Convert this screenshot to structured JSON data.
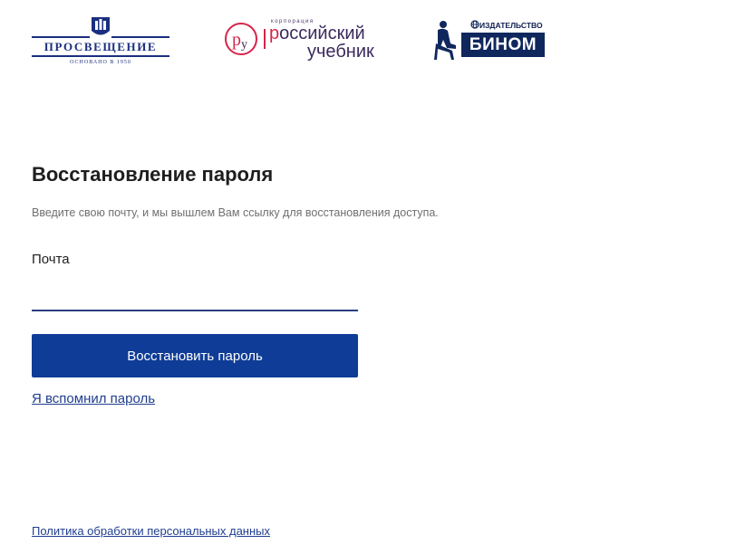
{
  "logos": {
    "prosveshchenie": {
      "name": "ПРОСВЕЩЕНИЕ",
      "since": "ОСНОВАНО В 1950",
      "brand_color": "#1a2f7f"
    },
    "russian_textbook": {
      "corp_label": "корпорация",
      "line1_first": "р",
      "line1_rest": "оссийский",
      "line2": "учебник",
      "accent_color": "#d6244a",
      "brand_color": "#3b2a5e"
    },
    "binom": {
      "publisher_label": "ИЗДАТЕЛЬСТВО",
      "name": "БИНОМ",
      "brand_color": "#10275d"
    }
  },
  "form": {
    "title": "Восстановление пароля",
    "subtitle": "Введите свою почту, и мы вышлем Вам ссылку для восстановления доступа.",
    "email_label": "Почта",
    "email_value": "",
    "submit_label": "Восстановить пароль",
    "remember_link": "Я вспомнил пароль",
    "accent_color": "#0f3c96"
  },
  "footer": {
    "policy_link": "Политика обработки персональных данных"
  }
}
